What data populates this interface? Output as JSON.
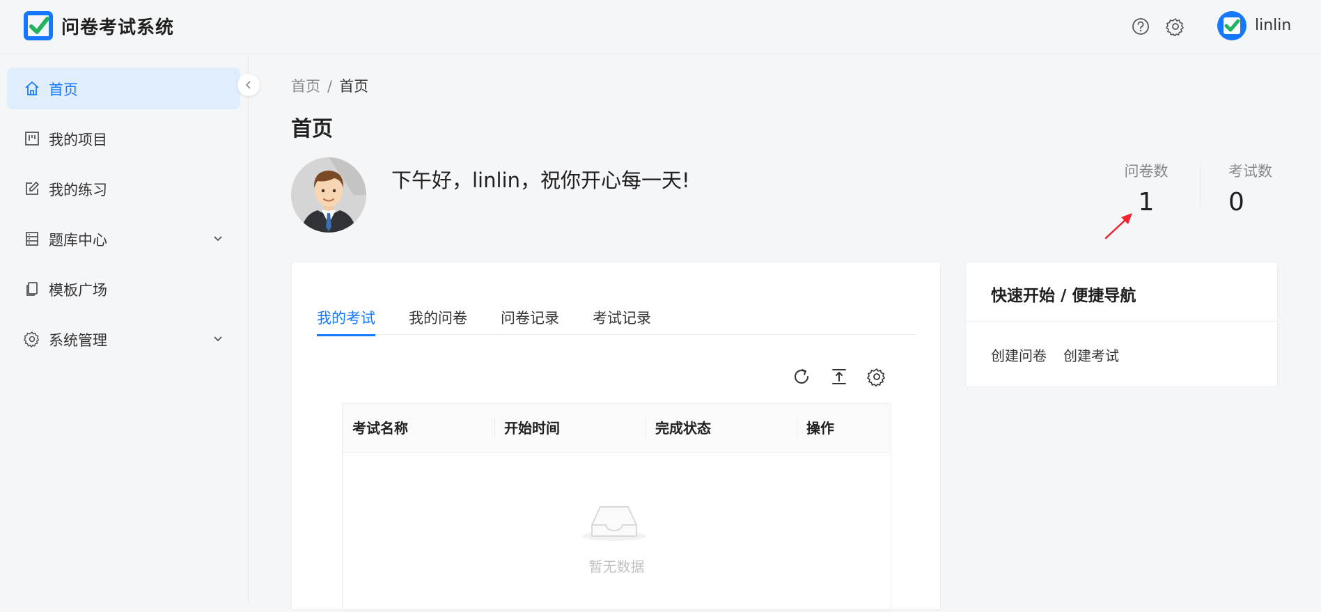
{
  "app": {
    "title": "问卷考试系统"
  },
  "header": {
    "help_icon": "question-circle-icon",
    "settings_icon": "gear-icon",
    "user_name": "linlin"
  },
  "sidebar": {
    "items": [
      {
        "label": "首页",
        "icon": "home-icon",
        "active": true
      },
      {
        "label": "我的项目",
        "icon": "project-icon"
      },
      {
        "label": "我的练习",
        "icon": "edit-icon"
      },
      {
        "label": "题库中心",
        "icon": "database-icon",
        "expandable": true
      },
      {
        "label": "模板广场",
        "icon": "copy-icon"
      },
      {
        "label": "系统管理",
        "icon": "gear-icon",
        "expandable": true
      }
    ]
  },
  "breadcrumb": {
    "parent": "首页",
    "separator": "/",
    "current": "首页"
  },
  "page": {
    "title": "首页",
    "greeting": "下午好，linlin，祝你开心每一天!",
    "stats": [
      {
        "label": "问卷数",
        "value": "1"
      },
      {
        "label": "考试数",
        "value": "0"
      }
    ]
  },
  "main_card": {
    "tabs": [
      "我的考试",
      "我的问卷",
      "问卷记录",
      "考试记录"
    ],
    "active_tab": "我的考试",
    "table": {
      "columns": [
        "考试名称",
        "开始时间",
        "完成状态",
        "操作"
      ],
      "rows": [],
      "empty_text": "暂无数据"
    }
  },
  "side_card": {
    "title": "快速开始 / 便捷导航",
    "links": [
      "创建问卷",
      "创建考试"
    ]
  },
  "colors": {
    "accent": "#1677ff",
    "active_bg": "#e0edfd",
    "annotation_arrow": "#f5222d"
  }
}
